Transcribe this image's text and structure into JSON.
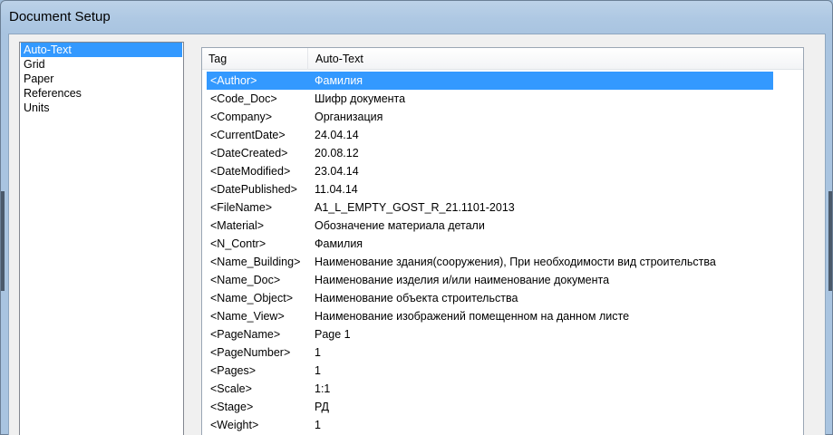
{
  "window": {
    "title": "Document Setup"
  },
  "sidebar": {
    "items": [
      {
        "label": "Auto-Text",
        "selected": true
      },
      {
        "label": "Grid",
        "selected": false
      },
      {
        "label": "Paper",
        "selected": false
      },
      {
        "label": "References",
        "selected": false
      },
      {
        "label": "Units",
        "selected": false
      }
    ]
  },
  "table": {
    "columns": [
      "Tag",
      "Auto-Text"
    ],
    "rows": [
      {
        "tag": "<Author>",
        "value": "Фамилия",
        "selected": true
      },
      {
        "tag": "<Code_Doc>",
        "value": "Шифр документа",
        "selected": false
      },
      {
        "tag": "<Company>",
        "value": "Организация",
        "selected": false
      },
      {
        "tag": "<CurrentDate>",
        "value": "24.04.14",
        "selected": false
      },
      {
        "tag": "<DateCreated>",
        "value": "20.08.12",
        "selected": false
      },
      {
        "tag": "<DateModified>",
        "value": "23.04.14",
        "selected": false
      },
      {
        "tag": "<DatePublished>",
        "value": "11.04.14",
        "selected": false
      },
      {
        "tag": "<FileName>",
        "value": "A1_L_EMPTY_GOST_R_21.1101-2013",
        "selected": false
      },
      {
        "tag": "<Material>",
        "value": "Обозначение материала детали",
        "selected": false
      },
      {
        "tag": "<N_Contr>",
        "value": "Фамилия",
        "selected": false
      },
      {
        "tag": "<Name_Building>",
        "value": "Наименование здания(сооружения), При необходимости вид строительства",
        "selected": false
      },
      {
        "tag": "<Name_Doc>",
        "value": "Наименование изделия и/или наименование документа",
        "selected": false
      },
      {
        "tag": "<Name_Object>",
        "value": "Наименование объекта строительства",
        "selected": false
      },
      {
        "tag": "<Name_View>",
        "value": "Наименование изображений помещенном на данном листе",
        "selected": false
      },
      {
        "tag": "<PageName>",
        "value": "Page 1",
        "selected": false
      },
      {
        "tag": "<PageNumber>",
        "value": "1",
        "selected": false
      },
      {
        "tag": "<Pages>",
        "value": "1",
        "selected": false
      },
      {
        "tag": "<Scale>",
        "value": "1:1",
        "selected": false
      },
      {
        "tag": "<Stage>",
        "value": "РД",
        "selected": false
      },
      {
        "tag": "<Weight>",
        "value": "1",
        "selected": false
      }
    ]
  },
  "colors": {
    "selection": "#3399ff",
    "titlebar": "#aec8e3",
    "dialog_bg": "#f0f0f0"
  }
}
